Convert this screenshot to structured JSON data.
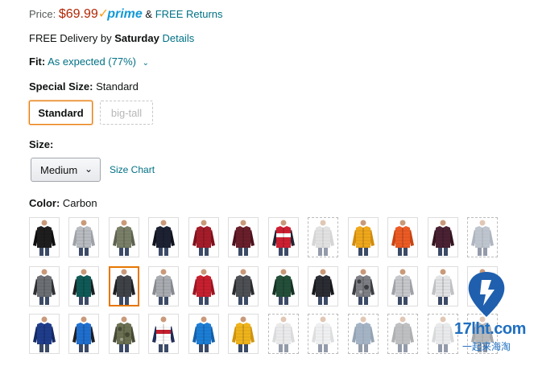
{
  "price": {
    "label": "Price:",
    "value": "$69.99",
    "prime_check": "✓",
    "prime_word": "prime",
    "amp": "&",
    "returns": "FREE Returns"
  },
  "delivery": {
    "text": "FREE Delivery by ",
    "day": "Saturday",
    "details": "Details"
  },
  "fit": {
    "label": "Fit:",
    "value": "As expected (77%)"
  },
  "special_size": {
    "label": "Special Size:",
    "value": "Standard",
    "options": [
      "Standard",
      "big-tall"
    ]
  },
  "size": {
    "label": "Size:",
    "selected": "Medium",
    "chart_link": "Size Chart"
  },
  "color": {
    "label": "Color:",
    "value": "Carbon"
  },
  "swatches": [
    [
      {
        "body": "#1e1e1e",
        "trim": "#0f0f0f"
      },
      {
        "body": "#b9bcc1",
        "trim": "#9ea2a8"
      },
      {
        "body": "#7a8068",
        "trim": "#5e634f"
      },
      {
        "body": "#1d2233",
        "trim": "#10131d"
      },
      {
        "body": "#a51d2a",
        "trim": "#7d111c"
      },
      {
        "body": "#6a1f2b",
        "trim": "#4c111b"
      },
      {
        "body": "#cf2033",
        "trim": "#222433",
        "band": "#ffffff"
      },
      {
        "body": "#c9c9c9",
        "trim": "#b3b3b3",
        "unavailable": true
      },
      {
        "body": "#f0a81c",
        "trim": "#d18b0c"
      },
      {
        "body": "#ec5b25",
        "trim": "#c84513"
      },
      {
        "body": "#4a2233",
        "trim": "#33151f"
      },
      {
        "body": "#8c97a8",
        "trim": "#6e7a8d",
        "unavailable": true
      }
    ],
    [
      {
        "body": "#6c6f74",
        "trim": "#2f3134"
      },
      {
        "body": "#0f5a57",
        "trim": "#1b1f22"
      },
      {
        "body": "#3f4247",
        "trim": "#1e2023",
        "selected": true
      },
      {
        "body": "#a9acb1",
        "trim": "#878a90"
      },
      {
        "body": "#c8202f",
        "trim": "#9a1522"
      },
      {
        "body": "#4d5054",
        "trim": "#2a2c2f"
      },
      {
        "body": "#24503a",
        "trim": "#153224"
      },
      {
        "body": "#2a2d33",
        "trim": "#16181c"
      },
      {
        "body": "#7e8086",
        "trim": "#3d3f44",
        "camo": true
      },
      {
        "body": "#c6c8cc",
        "trim": "#9fa2a7"
      },
      {
        "body": "#e2e3e5",
        "trim": "#bfc1c4"
      },
      {
        "body": "#3a3c41",
        "trim": "#1f2024"
      }
    ],
    [
      {
        "body": "#1f3d8c",
        "trim": "#152a63"
      },
      {
        "body": "#1f6fd0",
        "trim": "#1b1f26"
      },
      {
        "body": "#6b7152",
        "trim": "#464a35",
        "camo": true
      },
      {
        "body": "#ffffff",
        "trim": "#1f2d57",
        "band": "#c8202f"
      },
      {
        "body": "#1c7ed6",
        "trim": "#1560a8"
      },
      {
        "body": "#f0b41c",
        "trim": "#d0940c"
      },
      {
        "body": "#d9dadc",
        "trim": "#bcbec1",
        "unavailable": true
      },
      {
        "body": "#e3e4e6",
        "trim": "#c2c4c7",
        "unavailable": true
      },
      {
        "body": "#5b7899",
        "trim": "#405a78",
        "unavailable": true
      },
      {
        "body": "#8a8d91",
        "trim": "#6d7075",
        "unavailable": true
      },
      {
        "body": "#d8d9db",
        "trim": "#b9bbbe",
        "unavailable": true
      },
      {
        "body": "#7f8286",
        "trim": "#5e6165",
        "unavailable": true
      }
    ]
  ],
  "watermark": {
    "text": "17lht.com",
    "subtext": "一起来海淘"
  }
}
